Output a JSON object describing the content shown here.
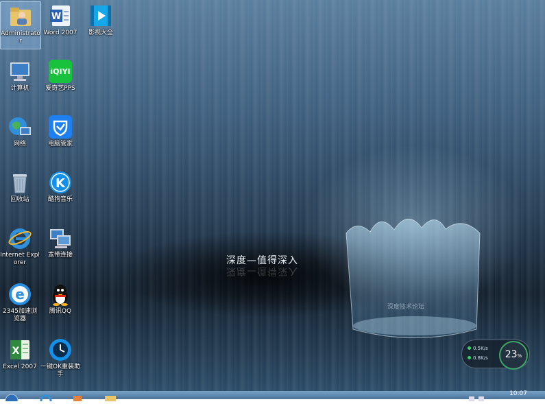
{
  "desktop": {
    "icons": [
      {
        "label": "Administrator",
        "icon": "user-folder-icon"
      },
      {
        "label": "Word 2007",
        "icon": "word-icon"
      },
      {
        "label": "影视大全",
        "icon": "video-player-icon"
      },
      {
        "label": "计算机",
        "icon": "computer-icon"
      },
      {
        "label": "爱奇艺PPS",
        "icon": "iqiyi-icon"
      },
      {
        "label": "网络",
        "icon": "network-icon"
      },
      {
        "label": "电脑管家",
        "icon": "pc-manager-icon"
      },
      {
        "label": "回收站",
        "icon": "recycle-bin-icon"
      },
      {
        "label": "酷狗音乐",
        "icon": "kugou-icon"
      },
      {
        "label": "Internet Explorer",
        "icon": "internet-explorer-icon"
      },
      {
        "label": "宽带连接",
        "icon": "broadband-icon"
      },
      {
        "label": "2345加速浏览器",
        "icon": "2345-browser-icon"
      },
      {
        "label": "腾讯QQ",
        "icon": "qq-icon"
      },
      {
        "label": "Excel 2007",
        "icon": "excel-icon"
      },
      {
        "label": "一键OK重装助手",
        "icon": "reinstall-helper-icon"
      }
    ],
    "slogan": "深度—值得深入",
    "forum": "深度技术论坛"
  },
  "widget": {
    "up": "0.5K/s",
    "down": "0.8K/s",
    "cpu": "23",
    "cpu_unit": "%"
  },
  "taskbar": {
    "clock": "10:07"
  },
  "colors": {
    "accent": "#3fa66a",
    "selection": "#8cb4dc"
  }
}
